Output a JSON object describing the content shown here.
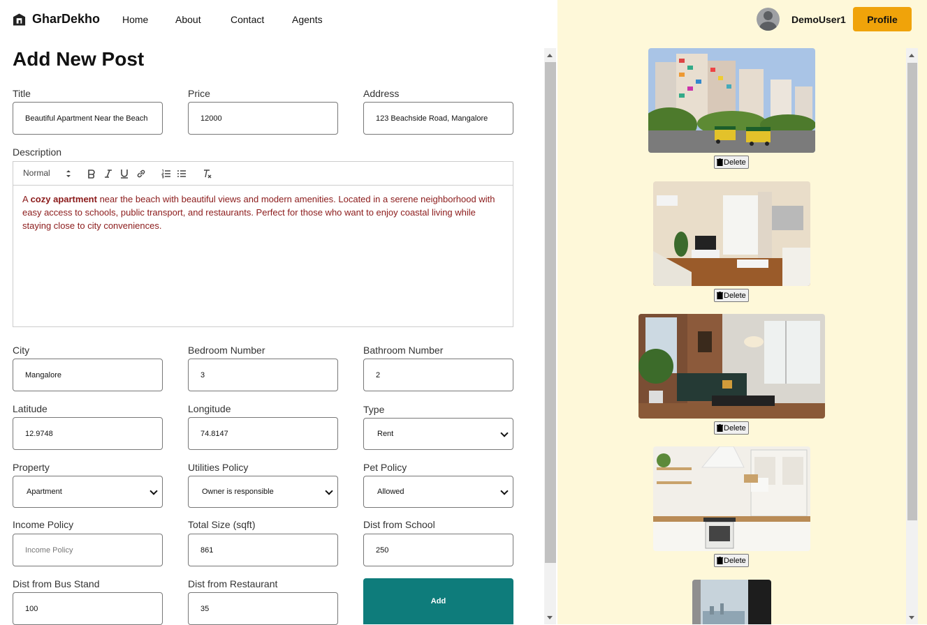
{
  "brand": {
    "name": "GharDekho"
  },
  "nav": {
    "home": "Home",
    "about": "About",
    "contact": "Contact",
    "agents": "Agents"
  },
  "user": {
    "name": "DemoUser1",
    "profile_label": "Profile"
  },
  "page_title": "Add New Post",
  "form": {
    "title": {
      "label": "Title",
      "value": "Beautiful Apartment Near the Beach"
    },
    "price": {
      "label": "Price",
      "value": "12000"
    },
    "address": {
      "label": "Address",
      "value": "123 Beachside Road, Mangalore"
    },
    "description": {
      "label": "Description",
      "format": "Normal",
      "text_part1": "A ",
      "text_bold": "cozy apartment",
      "text_part2": " near the beach with beautiful views and modern amenities. Located in a serene neighborhood with easy access to schools, public transport, and restaurants. Perfect for those who want to enjoy coastal living while staying close to city conveniences."
    },
    "city": {
      "label": "City",
      "value": "Mangalore"
    },
    "bedroom": {
      "label": "Bedroom Number",
      "value": "3"
    },
    "bathroom": {
      "label": "Bathroom Number",
      "value": "2"
    },
    "latitude": {
      "label": "Latitude",
      "value": "12.9748"
    },
    "longitude": {
      "label": "Longitude",
      "value": "74.8147"
    },
    "type": {
      "label": "Type",
      "value": "Rent"
    },
    "property": {
      "label": "Property",
      "value": "Apartment"
    },
    "utilities": {
      "label": "Utilities Policy",
      "value": "Owner is responsible"
    },
    "pet": {
      "label": "Pet Policy",
      "value": "Allowed"
    },
    "income": {
      "label": "Income Policy",
      "placeholder": "Income Policy"
    },
    "size": {
      "label": "Total Size (sqft)",
      "value": "861"
    },
    "school": {
      "label": "Dist from School",
      "value": "250"
    },
    "bus": {
      "label": "Dist from Bus Stand",
      "value": "100"
    },
    "restaurant": {
      "label": "Dist from Restaurant",
      "value": "35"
    },
    "add_label": "Add"
  },
  "images": {
    "delete_label": "Delete"
  }
}
